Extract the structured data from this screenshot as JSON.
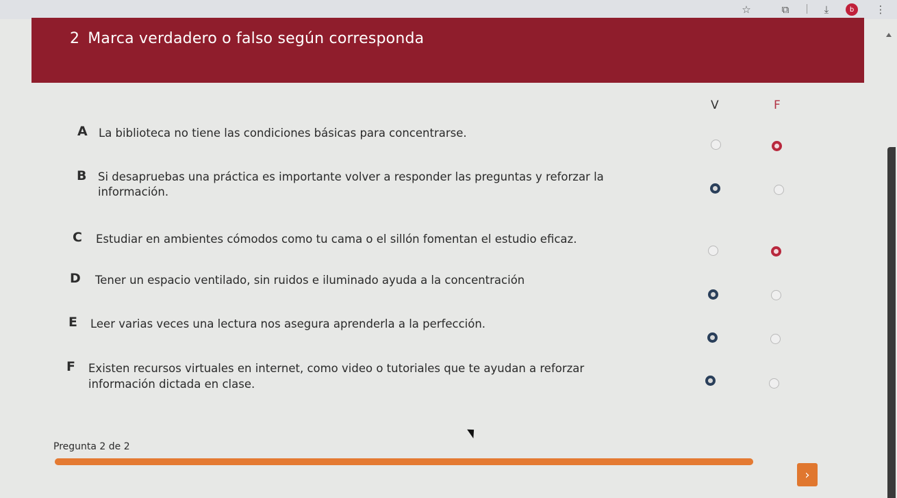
{
  "browser": {
    "star_icon": "star-icon",
    "extensions_icon": "puzzle-icon",
    "download_icon": "download-icon",
    "avatar_initial": "b",
    "menu_icon": "kebab-menu-icon"
  },
  "question": {
    "number": "2",
    "title": "Marca verdadero o falso según corresponda",
    "header_color": "#8f1d2c"
  },
  "columns": {
    "true_label": "V",
    "false_label": "F"
  },
  "statements": [
    {
      "letter": "A",
      "line1": "La biblioteca no tiene las condiciones básicas para concentrarse.",
      "line2": "",
      "selected": "F"
    },
    {
      "letter": "B",
      "line1": "Si desapruebas una práctica es importante volver a responder las preguntas y reforzar la",
      "line2": "información.",
      "selected": "V"
    },
    {
      "letter": "C",
      "line1": "Estudiar en ambientes cómodos como tu cama o el sillón fomentan el estudio eficaz.",
      "line2": "",
      "selected": "F"
    },
    {
      "letter": "D",
      "line1": "Tener un espacio ventilado, sin ruidos e iluminado ayuda a la concentración",
      "line2": "",
      "selected": "V"
    },
    {
      "letter": "E",
      "line1": "Leer varias veces una lectura nos asegura aprenderla a la perfección.",
      "line2": "",
      "selected": "V"
    },
    {
      "letter": "F",
      "line1": "Existen recursos virtuales en internet, como video o tutoriales que te ayudan a reforzar",
      "line2": "información dictada en clase.",
      "selected": "V"
    }
  ],
  "footer": {
    "progress_label": "Pregunta 2 de 2",
    "progress_fraction": 1.0,
    "accent_color": "#e47a32",
    "next_icon": "chevron-right-icon",
    "next_label": "›"
  }
}
